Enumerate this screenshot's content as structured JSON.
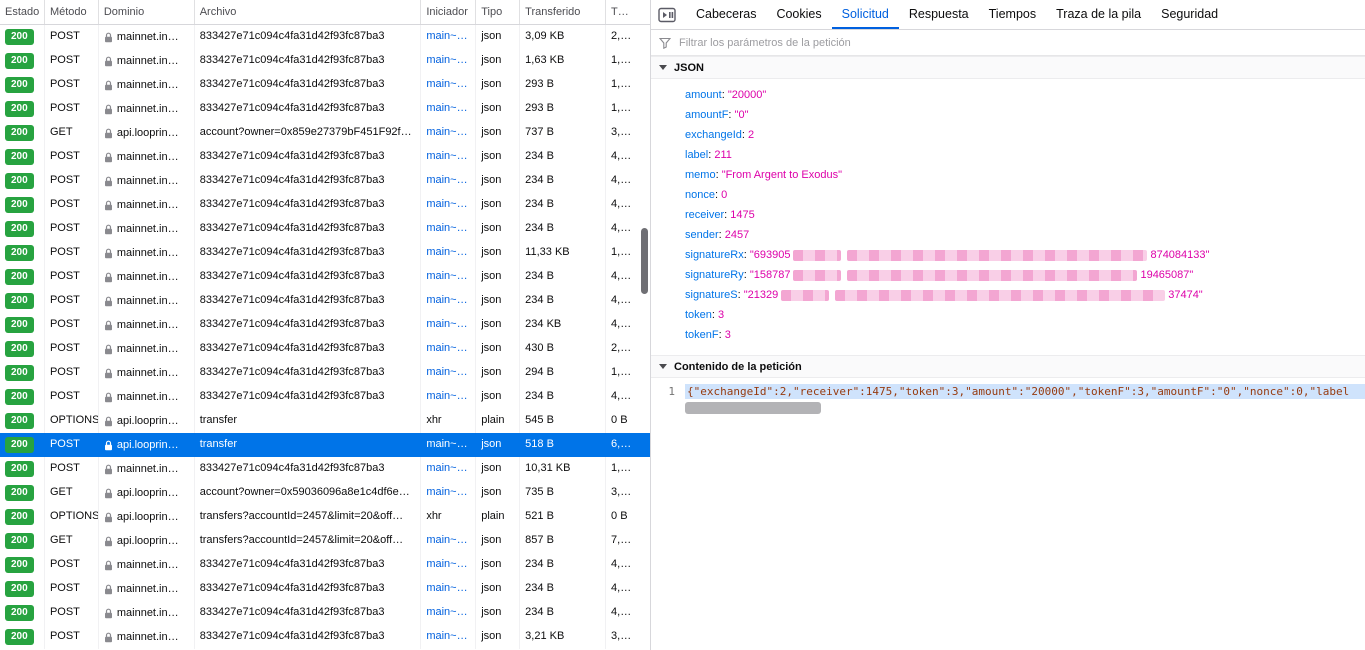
{
  "colors": {
    "status_ok": "#27a340",
    "selection_blue": "#0074e8",
    "link_blue": "#0060df",
    "property_key_blue": "#0074e8",
    "property_value_magenta": "#dd00a9",
    "redaction_pink": "#f3a6d2"
  },
  "icons": {
    "panel": "play-pause-icon",
    "filter": "funnel-icon",
    "domain_security": "lock-icon",
    "section_toggle": "triangle-down-icon"
  },
  "table": {
    "columns": [
      "Estado",
      "Método",
      "Dominio",
      "Archivo",
      "Iniciador",
      "Tipo",
      "Transferido",
      "T…"
    ],
    "rows": [
      {
        "status": "200",
        "method": "POST",
        "domain": "mainnet.in…",
        "file": "833427e71c094c4fa31d42f93fc87ba3",
        "initiator": "main~…",
        "initiator_link": true,
        "type": "json",
        "transferred": "3,09 KB",
        "size": "2,…",
        "selected": false
      },
      {
        "status": "200",
        "method": "POST",
        "domain": "mainnet.in…",
        "file": "833427e71c094c4fa31d42f93fc87ba3",
        "initiator": "main~…",
        "initiator_link": true,
        "type": "json",
        "transferred": "1,63 KB",
        "size": "1,…",
        "selected": false
      },
      {
        "status": "200",
        "method": "POST",
        "domain": "mainnet.in…",
        "file": "833427e71c094c4fa31d42f93fc87ba3",
        "initiator": "main~…",
        "initiator_link": true,
        "type": "json",
        "transferred": "293 B",
        "size": "1,…",
        "selected": false
      },
      {
        "status": "200",
        "method": "POST",
        "domain": "mainnet.in…",
        "file": "833427e71c094c4fa31d42f93fc87ba3",
        "initiator": "main~…",
        "initiator_link": true,
        "type": "json",
        "transferred": "293 B",
        "size": "1,…",
        "selected": false
      },
      {
        "status": "200",
        "method": "GET",
        "domain": "api.looprin…",
        "file": "account?owner=0x859e27379bF451F92f…",
        "initiator": "main~…",
        "initiator_link": true,
        "type": "json",
        "transferred": "737 B",
        "size": "3,…",
        "selected": false
      },
      {
        "status": "200",
        "method": "POST",
        "domain": "mainnet.in…",
        "file": "833427e71c094c4fa31d42f93fc87ba3",
        "initiator": "main~…",
        "initiator_link": true,
        "type": "json",
        "transferred": "234 B",
        "size": "4,…",
        "selected": false
      },
      {
        "status": "200",
        "method": "POST",
        "domain": "mainnet.in…",
        "file": "833427e71c094c4fa31d42f93fc87ba3",
        "initiator": "main~…",
        "initiator_link": true,
        "type": "json",
        "transferred": "234 B",
        "size": "4,…",
        "selected": false
      },
      {
        "status": "200",
        "method": "POST",
        "domain": "mainnet.in…",
        "file": "833427e71c094c4fa31d42f93fc87ba3",
        "initiator": "main~…",
        "initiator_link": true,
        "type": "json",
        "transferred": "234 B",
        "size": "4,…",
        "selected": false
      },
      {
        "status": "200",
        "method": "POST",
        "domain": "mainnet.in…",
        "file": "833427e71c094c4fa31d42f93fc87ba3",
        "initiator": "main~…",
        "initiator_link": true,
        "type": "json",
        "transferred": "234 B",
        "size": "4,…",
        "selected": false
      },
      {
        "status": "200",
        "method": "POST",
        "domain": "mainnet.in…",
        "file": "833427e71c094c4fa31d42f93fc87ba3",
        "initiator": "main~…",
        "initiator_link": true,
        "type": "json",
        "transferred": "11,33 KB",
        "size": "1,…",
        "selected": false
      },
      {
        "status": "200",
        "method": "POST",
        "domain": "mainnet.in…",
        "file": "833427e71c094c4fa31d42f93fc87ba3",
        "initiator": "main~…",
        "initiator_link": true,
        "type": "json",
        "transferred": "234 B",
        "size": "4,…",
        "selected": false
      },
      {
        "status": "200",
        "method": "POST",
        "domain": "mainnet.in…",
        "file": "833427e71c094c4fa31d42f93fc87ba3",
        "initiator": "main~…",
        "initiator_link": true,
        "type": "json",
        "transferred": "234 B",
        "size": "4,…",
        "selected": false
      },
      {
        "status": "200",
        "method": "POST",
        "domain": "mainnet.in…",
        "file": "833427e71c094c4fa31d42f93fc87ba3",
        "initiator": "main~…",
        "initiator_link": true,
        "type": "json",
        "transferred": "234 KB",
        "size": "4,…",
        "selected": false
      },
      {
        "status": "200",
        "method": "POST",
        "domain": "mainnet.in…",
        "file": "833427e71c094c4fa31d42f93fc87ba3",
        "initiator": "main~…",
        "initiator_link": true,
        "type": "json",
        "transferred": "430 B",
        "size": "2,…",
        "selected": false
      },
      {
        "status": "200",
        "method": "POST",
        "domain": "mainnet.in…",
        "file": "833427e71c094c4fa31d42f93fc87ba3",
        "initiator": "main~…",
        "initiator_link": true,
        "type": "json",
        "transferred": "294 B",
        "size": "1,…",
        "selected": false
      },
      {
        "status": "200",
        "method": "POST",
        "domain": "mainnet.in…",
        "file": "833427e71c094c4fa31d42f93fc87ba3",
        "initiator": "main~…",
        "initiator_link": true,
        "type": "json",
        "transferred": "234 B",
        "size": "4,…",
        "selected": false
      },
      {
        "status": "200",
        "method": "OPTIONS",
        "domain": "api.looprin…",
        "file": "transfer",
        "initiator": "xhr",
        "initiator_link": false,
        "type": "plain",
        "transferred": "545 B",
        "size": "0 B",
        "selected": false
      },
      {
        "status": "200",
        "method": "POST",
        "domain": "api.looprin…",
        "file": "transfer",
        "initiator": "main~…",
        "initiator_link": true,
        "type": "json",
        "transferred": "518 B",
        "size": "6,…",
        "selected": true
      },
      {
        "status": "200",
        "method": "POST",
        "domain": "mainnet.in…",
        "file": "833427e71c094c4fa31d42f93fc87ba3",
        "initiator": "main~…",
        "initiator_link": true,
        "type": "json",
        "transferred": "10,31 KB",
        "size": "1,…",
        "selected": false
      },
      {
        "status": "200",
        "method": "GET",
        "domain": "api.looprin…",
        "file": "account?owner=0x59036096a8e1c4df6e…",
        "initiator": "main~…",
        "initiator_link": true,
        "type": "json",
        "transferred": "735 B",
        "size": "3,…",
        "selected": false
      },
      {
        "status": "200",
        "method": "OPTIONS",
        "domain": "api.looprin…",
        "file": "transfers?accountId=2457&limit=20&off…",
        "initiator": "xhr",
        "initiator_link": false,
        "type": "plain",
        "transferred": "521 B",
        "size": "0 B",
        "selected": false
      },
      {
        "status": "200",
        "method": "GET",
        "domain": "api.looprin…",
        "file": "transfers?accountId=2457&limit=20&off…",
        "initiator": "main~…",
        "initiator_link": true,
        "type": "json",
        "transferred": "857 B",
        "size": "7,…",
        "selected": false
      },
      {
        "status": "200",
        "method": "POST",
        "domain": "mainnet.in…",
        "file": "833427e71c094c4fa31d42f93fc87ba3",
        "initiator": "main~…",
        "initiator_link": true,
        "type": "json",
        "transferred": "234 B",
        "size": "4,…",
        "selected": false
      },
      {
        "status": "200",
        "method": "POST",
        "domain": "mainnet.in…",
        "file": "833427e71c094c4fa31d42f93fc87ba3",
        "initiator": "main~…",
        "initiator_link": true,
        "type": "json",
        "transferred": "234 B",
        "size": "4,…",
        "selected": false
      },
      {
        "status": "200",
        "method": "POST",
        "domain": "mainnet.in…",
        "file": "833427e71c094c4fa31d42f93fc87ba3",
        "initiator": "main~…",
        "initiator_link": true,
        "type": "json",
        "transferred": "234 B",
        "size": "4,…",
        "selected": false
      },
      {
        "status": "200",
        "method": "POST",
        "domain": "mainnet.in…",
        "file": "833427e71c094c4fa31d42f93fc87ba3",
        "initiator": "main~…",
        "initiator_link": true,
        "type": "json",
        "transferred": "3,21 KB",
        "size": "3,…",
        "selected": false
      }
    ]
  },
  "details": {
    "toolbar": {
      "tabs": [
        "Cabeceras",
        "Cookies",
        "Solicitud",
        "Respuesta",
        "Tiempos",
        "Traza de la pila",
        "Seguridad"
      ],
      "active_tab": "Solicitud"
    },
    "filter": {
      "placeholder": "Filtrar los parámetros de la petición"
    },
    "json_section": {
      "title": "JSON",
      "properties": [
        {
          "key": "amount",
          "value": "\"20000\""
        },
        {
          "key": "amountF",
          "value": "\"0\""
        },
        {
          "key": "exchangeId",
          "value": "2"
        },
        {
          "key": "label",
          "value": "211"
        },
        {
          "key": "memo",
          "value": "\"From Argent to Exodus\""
        },
        {
          "key": "nonce",
          "value": "0"
        },
        {
          "key": "receiver",
          "value": "1475"
        },
        {
          "key": "sender",
          "value": "2457"
        },
        {
          "key": "signatureRx",
          "redacted": true,
          "value_prefix": "\"693905",
          "value_suffix": "874084133\""
        },
        {
          "key": "signatureRy",
          "redacted": true,
          "value_prefix": "\"158787",
          "value_suffix": "19465087\""
        },
        {
          "key": "signatureS",
          "redacted": true,
          "value_prefix": "\"21329",
          "value_suffix": "37474\""
        },
        {
          "key": "token",
          "value": "3"
        },
        {
          "key": "tokenF",
          "value": "3"
        }
      ]
    },
    "payload_section": {
      "title": "Contenido de la petición",
      "line_number": "1",
      "content": "{\"exchangeId\":2,\"receiver\":1475,\"token\":3,\"amount\":\"20000\",\"tokenF\":3,\"amountF\":\"0\",\"nonce\":0,\"label"
    }
  }
}
